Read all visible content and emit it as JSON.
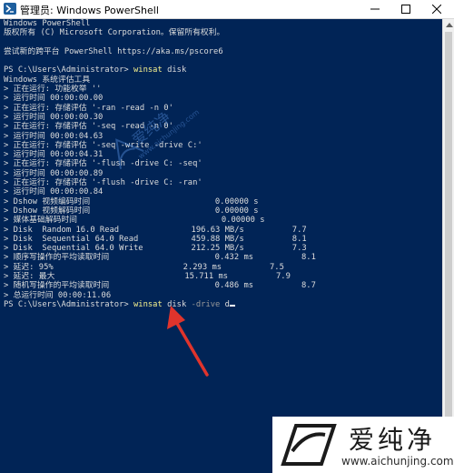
{
  "window": {
    "title": "管理员: Windows PowerShell"
  },
  "colors": {
    "console_background": "#012456",
    "console_text": "#dcdcdc",
    "command_highlight": "#f6f18e",
    "parameter_text": "#9a9a9a",
    "arrow": "#e0342c"
  },
  "console": {
    "lines": [
      {
        "text": "Windows PowerShell"
      },
      {
        "text": "版权所有 (C) Microsoft Corporation。保留所有权利。"
      },
      {
        "text": ""
      },
      {
        "text": "尝试新的跨平台 PowerShell https://aka.ms/pscore6"
      },
      {
        "text": ""
      },
      {
        "prompt": "PS C:\\Users\\Administrator> ",
        "cmd": "winsat",
        "rest": " disk"
      },
      {
        "text": "Windows 系统评估工具"
      },
      {
        "text": "> 正在运行: 功能枚举 ''"
      },
      {
        "text": "> 运行时间 00:00:00.00"
      },
      {
        "text": "> 正在运行: 存储评估 '-ran -read -n 0'"
      },
      {
        "text": "> 运行时间 00:00:00.30"
      },
      {
        "text": "> 正在运行: 存储评估 '-seq -read -n 0'"
      },
      {
        "text": "> 运行时间 00:00:04.63"
      },
      {
        "text": "> 正在运行: 存储评估 '-seq -write -drive C:'"
      },
      {
        "text": "> 运行时间 00:00:04.31"
      },
      {
        "text": "> 正在运行: 存储评估 '-flush -drive C: -seq'"
      },
      {
        "text": "> 运行时间 00:00:00.89"
      },
      {
        "text": "> 正在运行: 存储评估 '-flush -drive C: -ran'"
      },
      {
        "text": "> 运行时间 00:00:00.84"
      },
      {
        "text": "> Dshow 视频编码时间                          0.00000 s"
      },
      {
        "text": "> Dshow 视频解码时间                          0.00000 s"
      },
      {
        "text": "> 媒体基础解码时间                              0.00000 s"
      },
      {
        "text": "> Disk  Random 16.0 Read               196.63 MB/s          7.7"
      },
      {
        "text": "> Disk  Sequential 64.0 Read           459.88 MB/s          8.1"
      },
      {
        "text": "> Disk  Sequential 64.0 Write          212.25 MB/s          7.3"
      },
      {
        "text": "> 顺序写操作的平均读取时间                      0.432 ms          8.1"
      },
      {
        "text": "> 延迟: 95%                           2.293 ms          7.5"
      },
      {
        "text": "> 延迟: 最大                           15.711 ms          7.9"
      },
      {
        "text": "> 随机写操作的平均读取时间                      0.486 ms          8.7"
      },
      {
        "text": "> 总运行时间 00:00:11.06"
      },
      {
        "prompt": "PS C:\\Users\\Administrator> ",
        "cmd": "winsat",
        "rest": " disk ",
        "param": "-drive",
        "rest2": " d",
        "cursor": true
      }
    ]
  },
  "watermark": {
    "diagonal_text": "爱纯净",
    "diagonal_url": "www.aichunjing.com",
    "logo_text": "爱纯净",
    "logo_url": "www.aichunjing.com"
  }
}
